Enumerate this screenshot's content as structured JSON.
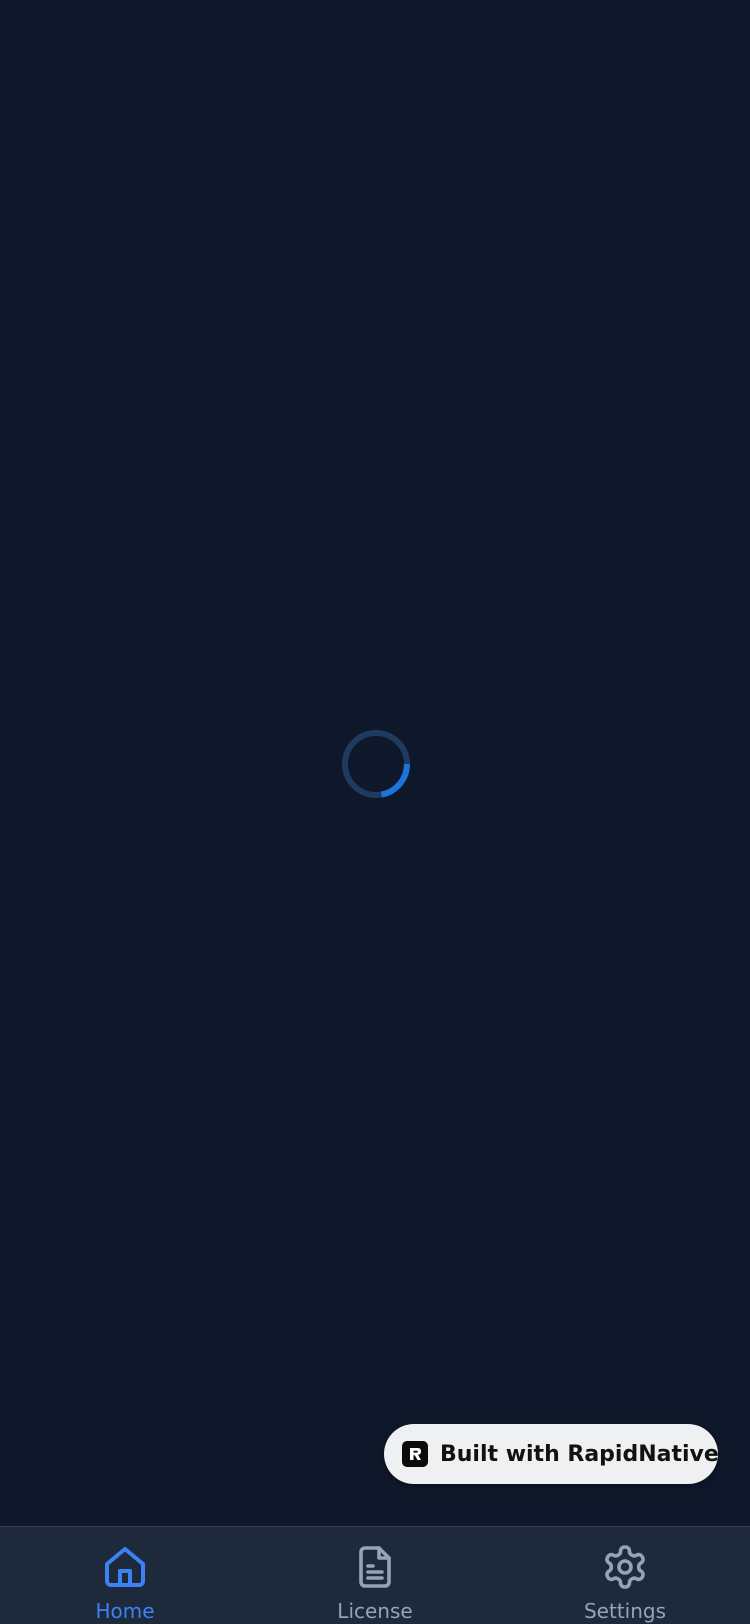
{
  "app": {
    "background_color": "#0f172a",
    "spinner_track_color": "#1e3a5f",
    "spinner_arc_color": "#1d74d8"
  },
  "badge": {
    "label": "Built with RapidNative",
    "logo_icon": "rapidnative-logo-icon"
  },
  "tabbar": {
    "active_color": "#3b82f6",
    "inactive_color": "#94a3b8",
    "tabs": [
      {
        "label": "Home",
        "icon": "home-icon",
        "active": true
      },
      {
        "label": "License",
        "icon": "document-icon",
        "active": false
      },
      {
        "label": "Settings",
        "icon": "gear-icon",
        "active": false
      }
    ]
  }
}
